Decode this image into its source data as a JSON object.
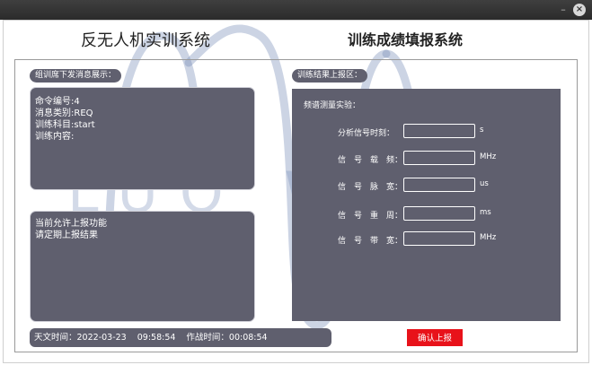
{
  "window": {
    "minimize_glyph": "–",
    "close_glyph": "×"
  },
  "header": {
    "left_title": "反无人机实训系统",
    "right_title": "训练成绩填报系统"
  },
  "watermark_text": "LUO WAVE",
  "left": {
    "section_tag": "组训席下发消息展示：",
    "message_lines": [
      "命令编号:4",
      "消息类别:REQ",
      "训练科目:start",
      "训练内容:"
    ],
    "notice_lines": [
      "当前允许上报功能",
      "请定期上报结果"
    ]
  },
  "right": {
    "section_tag": "训练结果上报区：",
    "experiment_title": "频谱测量实验：",
    "fields": [
      {
        "label": "分析信号时刻：",
        "value": "",
        "unit": "s"
      },
      {
        "label": "信　号　载　频：",
        "value": "",
        "unit": "MHz"
      },
      {
        "label": "信　号　脉　宽：",
        "value": "",
        "unit": "us"
      },
      {
        "label": "信　号　重　周：",
        "value": "",
        "unit": "ms"
      },
      {
        "label": "信　号　带　宽：",
        "value": "",
        "unit": "MHz"
      }
    ],
    "submit_label": "确认上报"
  },
  "status": {
    "astro_label": "天文时间：",
    "astro_date": "2022-03-23",
    "astro_time": "09:58:54",
    "combat_label": "作战时间：",
    "combat_time": "00:08:54"
  },
  "colors": {
    "panel": "#5f5f6e",
    "submit": "#e8121a",
    "watermark": "#6e85b3"
  }
}
